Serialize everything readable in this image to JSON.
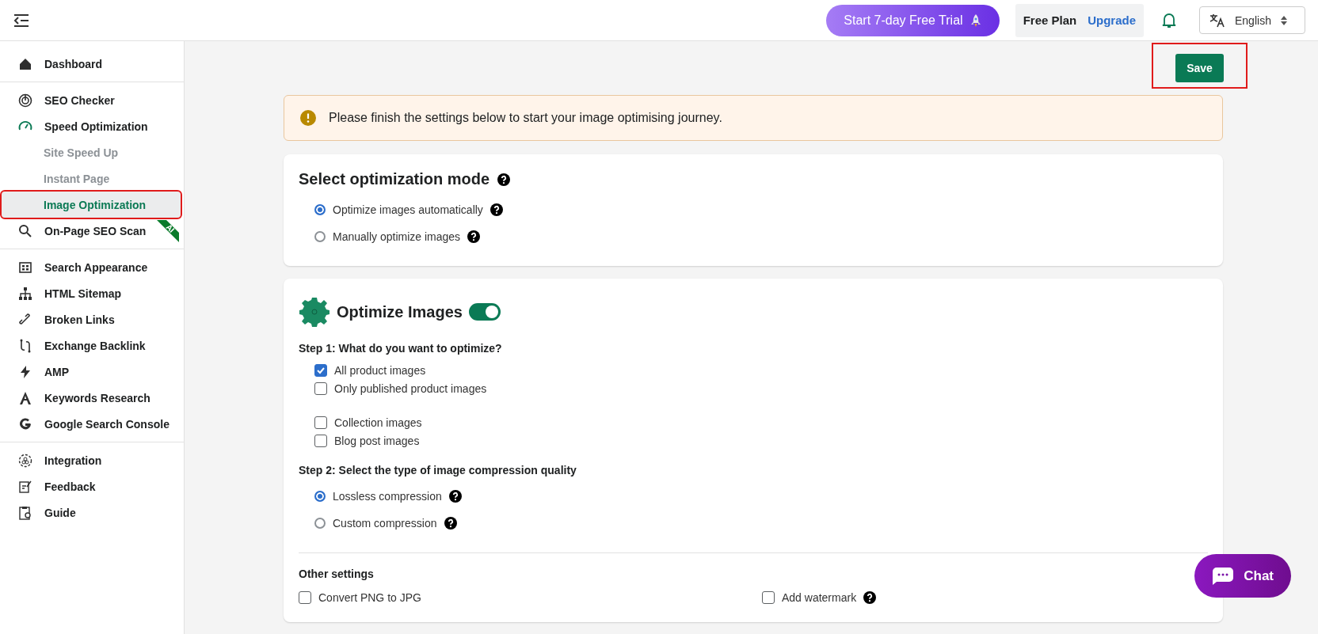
{
  "topbar": {
    "trial_button": "Start 7-day Free Trial",
    "plan": "Free Plan",
    "upgrade": "Upgrade",
    "language": "English"
  },
  "sidebar": {
    "groups": [
      [
        {
          "label": "Dashboard",
          "selected": false,
          "highlighted": false
        }
      ],
      [
        {
          "label": "SEO Checker",
          "selected": false,
          "highlighted": false
        },
        {
          "label": "Speed Optimization",
          "selected": true,
          "highlighted": false,
          "children": [
            {
              "label": "Site Speed Up",
              "selected": false,
              "highlighted": false
            },
            {
              "label": "Instant Page",
              "selected": false,
              "highlighted": false
            },
            {
              "label": "Image Optimization",
              "selected": true,
              "highlighted": true
            }
          ]
        },
        {
          "label": "On-Page SEO Scan",
          "selected": false,
          "highlighted": false,
          "badge": "AI"
        }
      ],
      [
        {
          "label": "Search Appearance",
          "selected": false,
          "highlighted": false
        },
        {
          "label": "HTML Sitemap",
          "selected": false,
          "highlighted": false
        },
        {
          "label": "Broken Links",
          "selected": false,
          "highlighted": false
        },
        {
          "label": "Exchange Backlink",
          "selected": false,
          "highlighted": false
        },
        {
          "label": "AMP",
          "selected": false,
          "highlighted": false
        },
        {
          "label": "Keywords Research",
          "selected": false,
          "highlighted": false
        },
        {
          "label": "Google Search Console",
          "selected": false,
          "highlighted": false
        }
      ],
      [
        {
          "label": "Integration",
          "selected": false,
          "highlighted": false
        },
        {
          "label": "Feedback",
          "selected": false,
          "highlighted": false
        },
        {
          "label": "Guide",
          "selected": false,
          "highlighted": false
        }
      ]
    ]
  },
  "save": {
    "label": "Save",
    "highlighted": true
  },
  "banner": "Please finish the settings below to start your image optimising journey.",
  "mode_card": {
    "title": "Select optimization mode",
    "options": [
      {
        "label": "Optimize images automatically",
        "selected": true
      },
      {
        "label": "Manually optimize images",
        "selected": false
      }
    ]
  },
  "images_card": {
    "title": "Optimize Images",
    "on": true,
    "step1": "Step 1: What do you want to optimize?",
    "step1_groups": [
      [
        {
          "label": "All product images",
          "checked": true
        },
        {
          "label": "Only published product images",
          "checked": false
        }
      ],
      [
        {
          "label": "Collection images",
          "checked": false
        },
        {
          "label": "Blog post images",
          "checked": false
        }
      ]
    ],
    "step2": "Step 2: Select the type of image compression quality",
    "step2_options": [
      {
        "label": "Lossless compression",
        "selected": true
      },
      {
        "label": "Custom compression",
        "selected": false
      }
    ],
    "other_title": "Other settings",
    "other": [
      {
        "label": "Convert PNG to JPG",
        "checked": false
      },
      {
        "label": "Add watermark",
        "checked": false,
        "help": true
      }
    ]
  },
  "chat": "Chat"
}
